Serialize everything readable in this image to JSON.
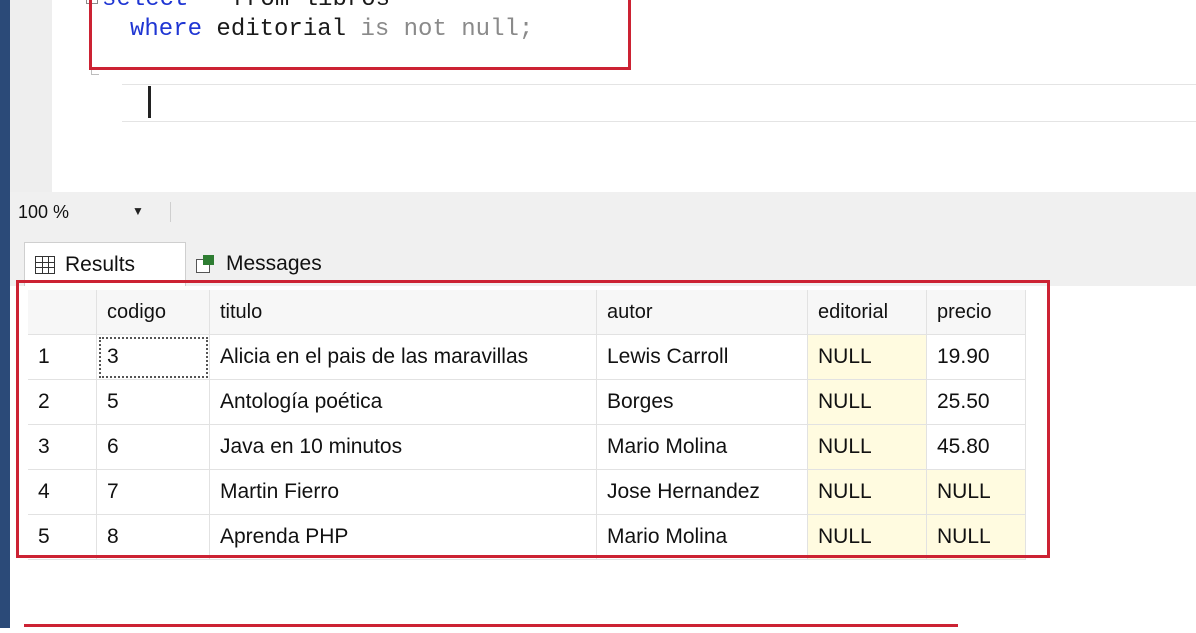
{
  "editor": {
    "line1": {
      "kw": "select",
      "rest": " * from libros"
    },
    "line2": {
      "kw": "where",
      "ident": " editorial",
      "op": " is not null;"
    }
  },
  "zoom": {
    "value": "100 %"
  },
  "tabs": [
    {
      "label": "Results",
      "icon": "grid-icon"
    },
    {
      "label": "Messages",
      "icon": "messages-icon"
    }
  ],
  "grid": {
    "headers": [
      "codigo",
      "titulo",
      "autor",
      "editorial",
      "precio"
    ],
    "rows": [
      {
        "n": "1",
        "codigo": "3",
        "titulo": "Alicia en el pais de las maravillas",
        "autor": "Lewis Carroll",
        "editorial": "NULL",
        "precio": "19.90"
      },
      {
        "n": "2",
        "codigo": "5",
        "titulo": "Antología poética",
        "autor": "Borges",
        "editorial": "NULL",
        "precio": "25.50"
      },
      {
        "n": "3",
        "codigo": "6",
        "titulo": "Java en 10 minutos",
        "autor": "Mario Molina",
        "editorial": "NULL",
        "precio": "45.80"
      },
      {
        "n": "4",
        "codigo": "7",
        "titulo": "Martin Fierro",
        "autor": "Jose Hernandez",
        "editorial": "NULL",
        "precio": "NULL"
      },
      {
        "n": "5",
        "codigo": "8",
        "titulo": "Aprenda PHP",
        "autor": "Mario Molina",
        "editorial": "NULL",
        "precio": "NULL"
      }
    ]
  },
  "colors": {
    "highlight": "#cc2233",
    "keyword": "#1f36d3",
    "null_bg": "#fffbe0"
  }
}
